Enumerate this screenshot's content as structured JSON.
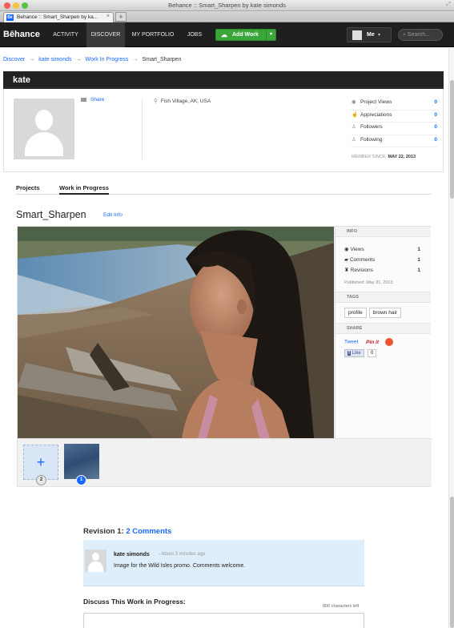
{
  "window": {
    "title": "Behance :: Smart_Sharpen by kate simonds",
    "traffic_colors": [
      "#f25d56",
      "#f5c244",
      "#5bc447"
    ]
  },
  "browser": {
    "tab_label": "Behance :: Smart_Sharpen by ka...",
    "tab_close": "×",
    "new_tab": "+",
    "favicon": "Bē"
  },
  "nav": {
    "logo": "Bēhance",
    "items": [
      "ACTIVITY",
      "DISCOVER",
      "MY PORTFOLIO",
      "JOBS"
    ],
    "active": "DISCOVER",
    "add_work": "Add Work",
    "me": "Me",
    "search_placeholder": "Search..."
  },
  "breadcrumb": {
    "items": [
      "Discover",
      "kate simonds",
      "Work In Progress"
    ],
    "current": "Smart_Sharpen",
    "sep": "→"
  },
  "profile": {
    "name": "kate",
    "share": "Share",
    "location": "Fish Village, AK, USA",
    "stats": [
      {
        "label": "Project Views",
        "value": "0",
        "icon": "eye-icon"
      },
      {
        "label": "Appreciations",
        "value": "0",
        "icon": "thumbs-up-icon"
      },
      {
        "label": "Followers",
        "value": "0",
        "icon": "person-icon"
      },
      {
        "label": "Following",
        "value": "0",
        "icon": "person-icon"
      }
    ],
    "member_since_label": "MEMBER SINCE:",
    "member_since": "MAY 22, 2013"
  },
  "tabs": [
    "Projects",
    "Work in Progress"
  ],
  "work": {
    "title": "Smart_Sharpen",
    "edit_info": "Edit Info",
    "info_heading": "INFO",
    "info": [
      {
        "label": "Views",
        "value": "1"
      },
      {
        "label": "Comments",
        "value": "1"
      },
      {
        "label": "Revisions",
        "value": "1"
      }
    ],
    "published": "Published: May 31, 2013",
    "tags_heading": "TAGS",
    "tags": [
      "profile",
      "brown hair"
    ],
    "share_heading": "SHARE",
    "tweet": "Tweet",
    "pinit": "Pin it",
    "like": "Like",
    "like_count": "0",
    "thumb_add_count": "2",
    "thumb_img_count": "1"
  },
  "revision": {
    "title": "Revision 1:",
    "comments": "2 Comments"
  },
  "comment": {
    "author": "kate simonds",
    "time": "- About 3 minutes ago",
    "text": "Image for the Wild Isles promo. Comments welcome."
  },
  "discuss": {
    "title": "Discuss This Work in Progress:",
    "chars_left": "800 characters left"
  }
}
